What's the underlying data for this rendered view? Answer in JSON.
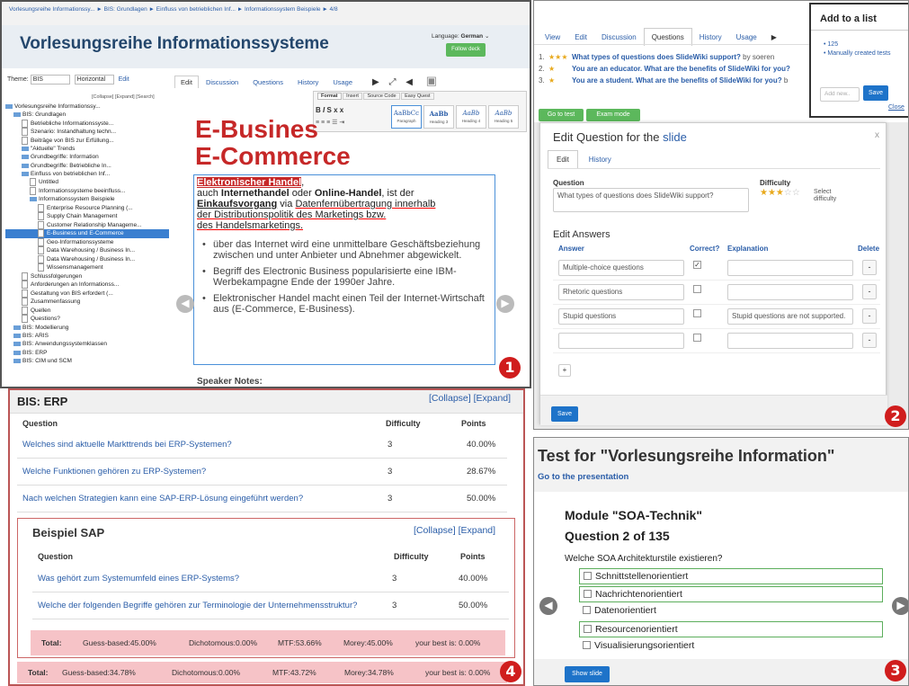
{
  "p1": {
    "breadcrumb": "Vorlesungsreihe Informationssy... ► BIS: Grundlagen ► Einfluss von betrieblichen Inf... ► Informationssystem Beispiele ► 4/8",
    "title": "Vorlesungsreihe Informationssysteme",
    "language_label": "Language:",
    "language": "German",
    "follow_btn": "Follow deck",
    "theme_label": "Theme:",
    "theme_value": "BIS",
    "layout_value": "Horizontal",
    "edit_link": "Edit",
    "tree_ctrl": "[Collapse] [Expand] [Search]",
    "tree": [
      {
        "t": "Vorlesungsreihe Informationssy...",
        "k": "fold",
        "l": 0
      },
      {
        "t": "BIS: Grundlagen",
        "k": "fold",
        "l": 1
      },
      {
        "t": "Betriebliche Informationssyste...",
        "k": "page",
        "l": 2
      },
      {
        "t": "Szenario: Instandhaltung techn...",
        "k": "page",
        "l": 2
      },
      {
        "t": "Beiträge von BIS zur Erfüllung...",
        "k": "page",
        "l": 2
      },
      {
        "t": "\"Aktuelle\" Trends",
        "k": "fold",
        "l": 2
      },
      {
        "t": "Grundbegriffe: Information",
        "k": "fold",
        "l": 2
      },
      {
        "t": "Grundbegriffe: Betriebliche In...",
        "k": "fold",
        "l": 2
      },
      {
        "t": "Einfluss von betrieblichen Inf...",
        "k": "fold",
        "l": 2
      },
      {
        "t": "Untitled",
        "k": "page",
        "l": 3
      },
      {
        "t": "Informationssysteme beeinfluss...",
        "k": "page",
        "l": 3
      },
      {
        "t": "Informationssystem Beispiele",
        "k": "fold",
        "l": 3
      },
      {
        "t": "Enterprise Resource Planning (...",
        "k": "page",
        "l": 4
      },
      {
        "t": "Supply Chain Management",
        "k": "page",
        "l": 4
      },
      {
        "t": "Customer Relationship Manageme...",
        "k": "page",
        "l": 4
      },
      {
        "t": "E-Business und E-Commerce",
        "k": "page sel",
        "l": 4
      },
      {
        "t": "Geo-Informationssysteme",
        "k": "page",
        "l": 4
      },
      {
        "t": "Data Warehousing / Business In...",
        "k": "page",
        "l": 4
      },
      {
        "t": "Data Warehousing / Business In...",
        "k": "page",
        "l": 4
      },
      {
        "t": "Wissensmanagement",
        "k": "page",
        "l": 4
      },
      {
        "t": "Schlussfolgerungen",
        "k": "page",
        "l": 2
      },
      {
        "t": "Anforderungen an Informationss...",
        "k": "page",
        "l": 2
      },
      {
        "t": "Gestaltung von BIS erfordert (...",
        "k": "page",
        "l": 2
      },
      {
        "t": "Zusammenfassung",
        "k": "page",
        "l": 2
      },
      {
        "t": "Quellen",
        "k": "page",
        "l": 2
      },
      {
        "t": "Questions?",
        "k": "page",
        "l": 2
      },
      {
        "t": "BIS: Modellierung",
        "k": "fold",
        "l": 1
      },
      {
        "t": "BIS: ARIS",
        "k": "fold",
        "l": 1
      },
      {
        "t": "BIS: Anwendungssystemklassen",
        "k": "fold",
        "l": 1
      },
      {
        "t": "BIS: ERP",
        "k": "fold",
        "l": 1
      },
      {
        "t": "BIS: CIM und SCM",
        "k": "fold",
        "l": 1
      }
    ],
    "tabs": [
      "Edit",
      "Discussion",
      "Questions",
      "History",
      "Usage"
    ],
    "toolbar_tabs": [
      "Format",
      "Insert",
      "Source Code",
      "Easy Quest"
    ],
    "styles": [
      {
        "sample": "AaBbCc",
        "name": "Paragraph"
      },
      {
        "sample": "AaBb",
        "name": "Heading 3"
      },
      {
        "sample": "AaBb",
        "name": "Heading 4"
      },
      {
        "sample": "AaBb",
        "name": "Heading 5"
      }
    ],
    "slide_title_1": "E-Busines",
    "slide_title_2": "E-Commerce",
    "def_term": "Elektronischer Handel",
    "def_line2_a": "auch ",
    "def_line2_b": "Internethandel",
    "def_line2_c": " oder ",
    "def_line2_d": "Online-Handel",
    "def_line2_e": ", ist der",
    "def_line3_a": "Einkaufsvorgang",
    "def_line3_b": " via ",
    "def_line3_c": "Datenfernübertragung innerhalb",
    "def_line4": "der Distributionspolitik des Marketings bzw.",
    "def_line5": "des Handelsmarketings.",
    "bullets": [
      "über das Internet wird eine unmittelbare Geschäftsbeziehung zwischen und unter Anbieter und Abnehmer abgewickelt.",
      "Begriff des Electronic Business popularisierte eine IBM-Werbekampagne Ende der 1990er Jahre.",
      "Elektronischer Handel macht einen Teil der Internet-Wirtschaft aus (E-Commerce, E-Business)."
    ],
    "speaker_notes": "Speaker Notes:",
    "badge": "1"
  },
  "p2": {
    "tabs": [
      "View",
      "Edit",
      "Discussion",
      "Questions",
      "History",
      "Usage"
    ],
    "questions": [
      {
        "n": "1.",
        "stars": "★★★",
        "text": "What types of questions does SlideWiki support?",
        "suffix": " by soeren"
      },
      {
        "n": "2.",
        "stars": "★",
        "text": "You are an educator. What are the benefits of SlideWiki for you?",
        "suffix": ""
      },
      {
        "n": "3.",
        "stars": "★",
        "text": "You are a student. What are the benefits of SlideWiki for you?",
        "suffix": " b"
      }
    ],
    "add_list": {
      "title": "Add to a list",
      "items": [
        "125",
        "Manually created tests"
      ],
      "placeholder": "Add new..",
      "save": "Save",
      "close": "Close"
    },
    "go_test": "Go to test",
    "exam_mode": "Exam mode",
    "modal_title": "Edit Question for the ",
    "modal_title_link": "slide",
    "modal_close": "x",
    "modal_tabs": [
      "Edit",
      "History"
    ],
    "question_label": "Question",
    "question_value": "What types of questions does SlideWiki support?",
    "difficulty_label": "Difficulty",
    "difficulty_stars": "★★★",
    "difficulty_empty": "☆☆",
    "select_difficulty": "Select difficulty",
    "edit_answers": "Edit Answers",
    "cols": [
      "Answer",
      "Correct?",
      "Explanation",
      "Delete"
    ],
    "answers": [
      {
        "a": "Multiple-choice questions",
        "c": "✓",
        "e": ""
      },
      {
        "a": "Rhetoric questions",
        "c": "",
        "e": ""
      },
      {
        "a": "Stupid questions",
        "c": "",
        "e": "Stupid questions are not supported."
      },
      {
        "a": "",
        "c": "",
        "e": ""
      }
    ],
    "delete_btn": "-",
    "add_btn": "+",
    "save": "Save",
    "badge": "2"
  },
  "p4": {
    "title": "BIS: ERP",
    "ctrl": "[Collapse] [Expand]",
    "headers": [
      "Question",
      "Difficulty",
      "Points"
    ],
    "rows": [
      {
        "q": "Welches sind aktuelle Markttrends bei ERP-Systemen?",
        "d": "3",
        "p": "40.00%"
      },
      {
        "q": "Welche Funktionen gehören zu ERP-Systemen?",
        "d": "3",
        "p": "28.67%"
      },
      {
        "q": "Nach welchen Strategien kann eine SAP-ERP-Lösung eingeführt werden?",
        "d": "3",
        "p": "50.00%"
      }
    ],
    "sub": {
      "title": "Beispiel SAP",
      "ctrl": "[Collapse] [Expand]",
      "rows": [
        {
          "q": "Was gehört zum Systemumfeld eines ERP-Systems?",
          "d": "3",
          "p": "40.00%"
        },
        {
          "q": "Welche der folgenden Begriffe gehören zur Terminologie der Unternehmensstruktur?",
          "d": "3",
          "p": "50.00%"
        }
      ],
      "total": {
        "label": "Total:",
        "g": "Guess-based:45.00%",
        "d": "Dichotomous:0.00%",
        "m": "MTF:53.66%",
        "r": "Morey:45.00%",
        "b": "your best is: 0.00%"
      }
    },
    "total": {
      "label": "Total:",
      "g": "Guess-based:34.78%",
      "d": "Dichotomous:0.00%",
      "m": "MTF:43.72%",
      "r": "Morey:34.78%",
      "b": "your best is: 0.00%"
    },
    "badge": "4"
  },
  "p3": {
    "title": "Test for \"Vorlesungsreihe Information\"",
    "goto": "Go to the presentation",
    "module": "Module \"SOA-Technik\"",
    "question_no": "Question 2 of 135",
    "question": "Welche SOA Architekturstile existieren?",
    "options": [
      {
        "t": "Schnittstellenorientiert",
        "hl": true
      },
      {
        "t": "Nachrichtenorientiert",
        "hl": true
      },
      {
        "t": "Datenorientiert",
        "hl": false
      },
      {
        "t": "Resourcenorientiert",
        "hl": true
      },
      {
        "t": "Visualisierungsorientiert",
        "hl": false
      }
    ],
    "show_slide": "Show slide",
    "badge": "3"
  },
  "colors": {
    "red": "#d01d1d",
    "green": "#5cb85c",
    "blue": "#1e73c9",
    "title_red": "#c62828"
  }
}
